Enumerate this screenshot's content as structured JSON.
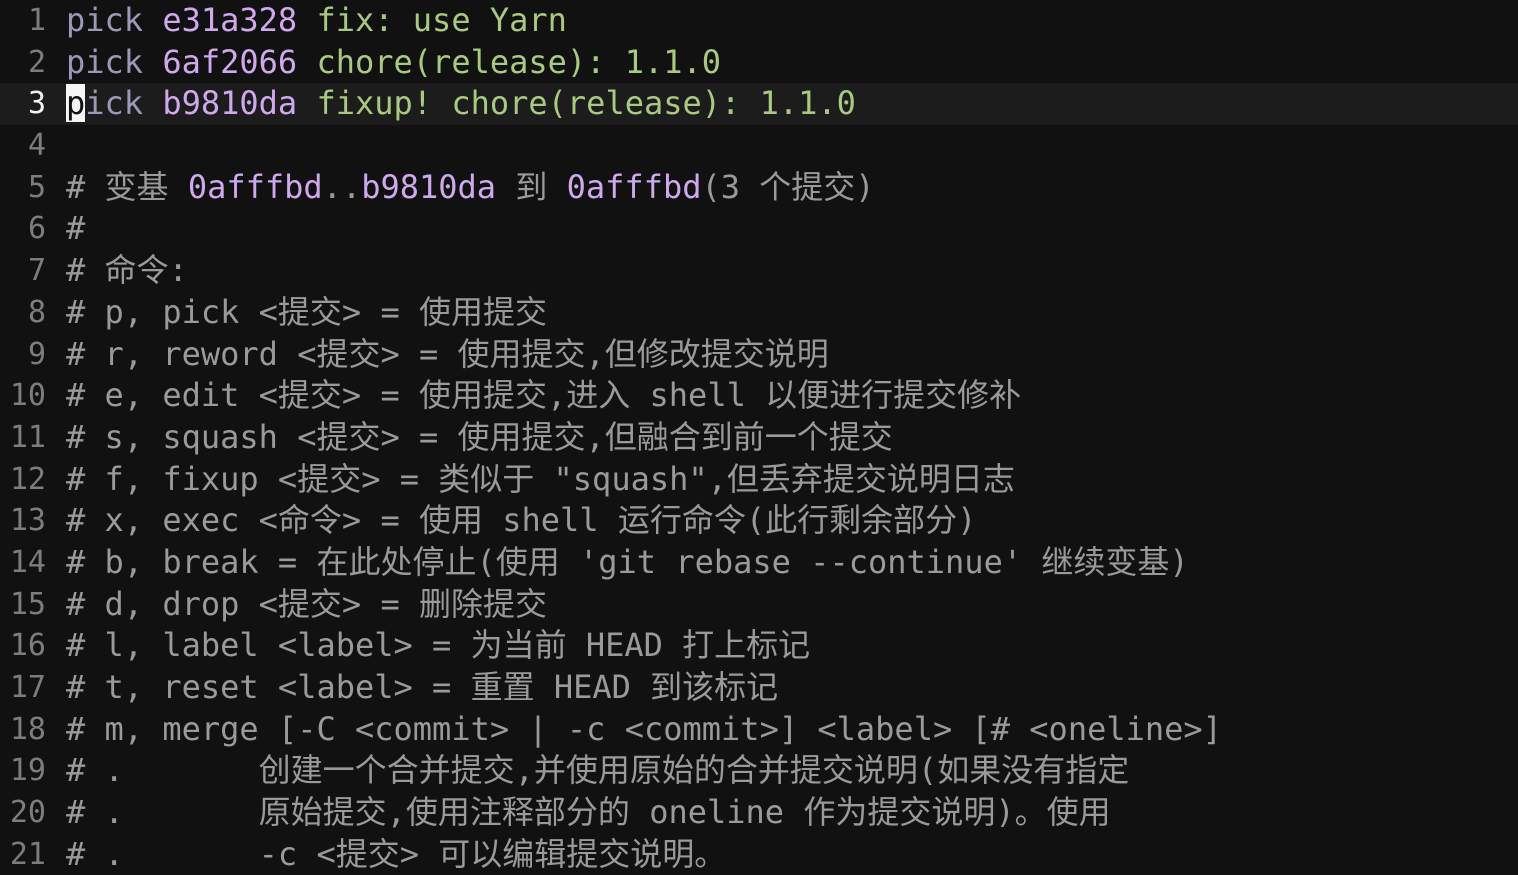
{
  "editor": {
    "app": "git-rebase-todo",
    "colors": {
      "background": "#111111",
      "current_line_background": "#1c1c1c",
      "gutter": "#7d7d7d",
      "gutter_active": "#f2f2f2",
      "command": "#9a9ab8",
      "hash": "#cfa8ee",
      "subject": "#a9c980",
      "comment": "#9a9a9a",
      "cursor_background": "#f5f5f5",
      "cursor_foreground": "#111111"
    },
    "cursor": {
      "line": 3,
      "column": 1,
      "character": "p"
    },
    "total_lines_visible": 21
  },
  "lines": [
    {
      "number": "1",
      "current": false,
      "tokens": [
        {
          "text": "pick",
          "kind": "cmd"
        },
        {
          "text": " ",
          "kind": "plain"
        },
        {
          "text": "e31a328",
          "kind": "hash"
        },
        {
          "text": " ",
          "kind": "plain"
        },
        {
          "text": "fix: use Yarn",
          "kind": "subject"
        }
      ]
    },
    {
      "number": "2",
      "current": false,
      "tokens": [
        {
          "text": "pick",
          "kind": "cmd"
        },
        {
          "text": " ",
          "kind": "plain"
        },
        {
          "text": "6af2066",
          "kind": "hash"
        },
        {
          "text": " ",
          "kind": "plain"
        },
        {
          "text": "chore(release): 1.1.0",
          "kind": "subject"
        }
      ]
    },
    {
      "number": "3",
      "current": true,
      "tokens": [
        {
          "text": "p",
          "kind": "cursor"
        },
        {
          "text": "ick",
          "kind": "cmd"
        },
        {
          "text": " ",
          "kind": "plain"
        },
        {
          "text": "b9810da",
          "kind": "hash"
        },
        {
          "text": " ",
          "kind": "plain"
        },
        {
          "text": "fixup! chore(release): 1.1.0",
          "kind": "subject"
        }
      ]
    },
    {
      "number": "4",
      "current": false,
      "tokens": []
    },
    {
      "number": "5",
      "current": false,
      "tokens": [
        {
          "text": "# 变基 ",
          "kind": "comment"
        },
        {
          "text": "0afffbd",
          "kind": "hash"
        },
        {
          "text": "..",
          "kind": "comment"
        },
        {
          "text": "b9810da",
          "kind": "hash"
        },
        {
          "text": " 到 ",
          "kind": "comment"
        },
        {
          "text": "0afffbd",
          "kind": "hash"
        },
        {
          "text": "(3 个提交)",
          "kind": "comment"
        }
      ]
    },
    {
      "number": "6",
      "current": false,
      "tokens": [
        {
          "text": "#",
          "kind": "comment"
        }
      ]
    },
    {
      "number": "7",
      "current": false,
      "tokens": [
        {
          "text": "# 命令:",
          "kind": "comment"
        }
      ]
    },
    {
      "number": "8",
      "current": false,
      "tokens": [
        {
          "text": "# p, pick <提交> = 使用提交",
          "kind": "comment"
        }
      ]
    },
    {
      "number": "9",
      "current": false,
      "tokens": [
        {
          "text": "# r, reword <提交> = 使用提交,但修改提交说明",
          "kind": "comment"
        }
      ]
    },
    {
      "number": "10",
      "current": false,
      "tokens": [
        {
          "text": "# e, edit <提交> = 使用提交,进入 shell 以便进行提交修补",
          "kind": "comment"
        }
      ]
    },
    {
      "number": "11",
      "current": false,
      "tokens": [
        {
          "text": "# s, squash <提交> = 使用提交,但融合到前一个提交",
          "kind": "comment"
        }
      ]
    },
    {
      "number": "12",
      "current": false,
      "tokens": [
        {
          "text": "# f, fixup <提交> = 类似于 \"squash\",但丢弃提交说明日志",
          "kind": "comment"
        }
      ]
    },
    {
      "number": "13",
      "current": false,
      "tokens": [
        {
          "text": "# x, exec <命令> = 使用 shell 运行命令(此行剩余部分)",
          "kind": "comment"
        }
      ]
    },
    {
      "number": "14",
      "current": false,
      "tokens": [
        {
          "text": "# b, break = 在此处停止(使用 'git rebase --continue' 继续变基)",
          "kind": "comment"
        }
      ]
    },
    {
      "number": "15",
      "current": false,
      "tokens": [
        {
          "text": "# d, drop <提交> = 删除提交",
          "kind": "comment"
        }
      ]
    },
    {
      "number": "16",
      "current": false,
      "tokens": [
        {
          "text": "# l, label <label> = 为当前 HEAD 打上标记",
          "kind": "comment"
        }
      ]
    },
    {
      "number": "17",
      "current": false,
      "tokens": [
        {
          "text": "# t, reset <label> = 重置 HEAD 到该标记",
          "kind": "comment"
        }
      ]
    },
    {
      "number": "18",
      "current": false,
      "tokens": [
        {
          "text": "# m, merge [-C <commit> | -c <commit>] <label> [# <oneline>]",
          "kind": "comment"
        }
      ]
    },
    {
      "number": "19",
      "current": false,
      "tokens": [
        {
          "text": "# .       创建一个合并提交,并使用原始的合并提交说明(如果没有指定",
          "kind": "comment"
        }
      ]
    },
    {
      "number": "20",
      "current": false,
      "tokens": [
        {
          "text": "# .       原始提交,使用注释部分的 oneline 作为提交说明)。使用",
          "kind": "comment"
        }
      ]
    },
    {
      "number": "21",
      "current": false,
      "tokens": [
        {
          "text": "# .       -c <提交> 可以编辑提交说明。",
          "kind": "comment"
        }
      ]
    }
  ]
}
